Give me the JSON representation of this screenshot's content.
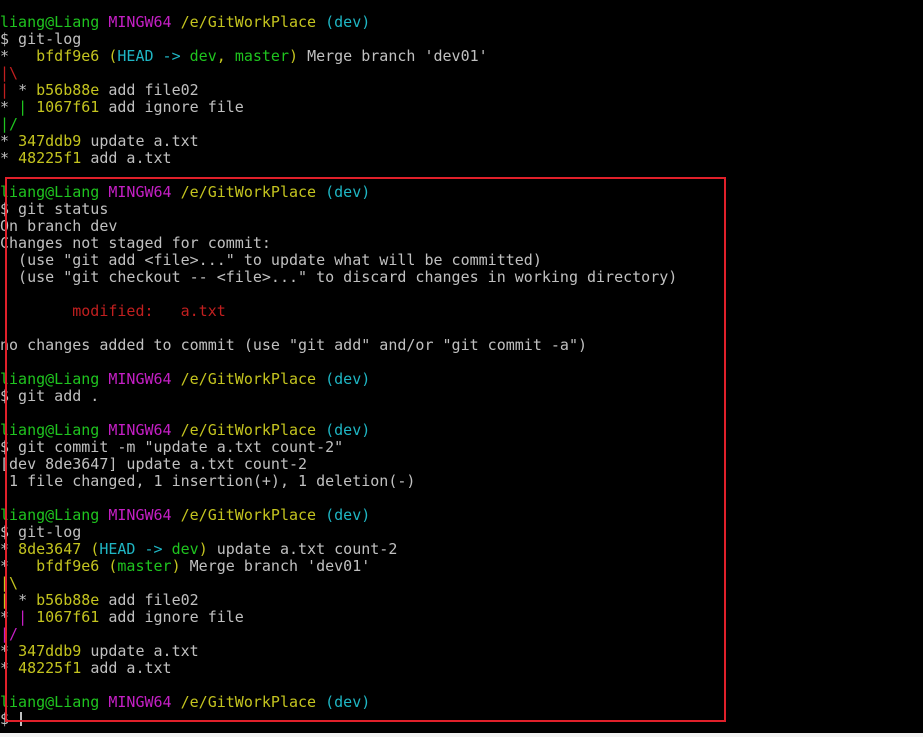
{
  "terminal": {
    "lines": [
      [
        {
          "t": "liang@Liang ",
          "c": "green"
        },
        {
          "t": "MINGW64 ",
          "c": "magenta"
        },
        {
          "t": "/e/GitWorkPlace",
          "c": "yellow"
        },
        {
          "t": " (dev)",
          "c": "cyan"
        }
      ],
      [
        {
          "t": "$ git-log",
          "c": "gray"
        }
      ],
      [
        {
          "t": "*   ",
          "c": "gray"
        },
        {
          "t": "bfdf9e6 ",
          "c": "yellow"
        },
        {
          "t": "(",
          "c": "yellow"
        },
        {
          "t": "HEAD -> ",
          "c": "cyan"
        },
        {
          "t": "dev",
          "c": "green"
        },
        {
          "t": ", ",
          "c": "yellow"
        },
        {
          "t": "master",
          "c": "green"
        },
        {
          "t": ") ",
          "c": "yellow"
        },
        {
          "t": "Merge branch 'dev01'",
          "c": "gray"
        }
      ],
      [
        {
          "t": "|\\",
          "c": "red"
        }
      ],
      [
        {
          "t": "| ",
          "c": "red"
        },
        {
          "t": "* ",
          "c": "gray"
        },
        {
          "t": "b56b88e ",
          "c": "yellow"
        },
        {
          "t": "add file02",
          "c": "gray"
        }
      ],
      [
        {
          "t": "* ",
          "c": "gray"
        },
        {
          "t": "| ",
          "c": "green"
        },
        {
          "t": "1067f61 ",
          "c": "yellow"
        },
        {
          "t": "add ignore file",
          "c": "gray"
        }
      ],
      [
        {
          "t": "|/",
          "c": "green"
        }
      ],
      [
        {
          "t": "* ",
          "c": "gray"
        },
        {
          "t": "347ddb9 ",
          "c": "yellow"
        },
        {
          "t": "update a.txt",
          "c": "gray"
        }
      ],
      [
        {
          "t": "* ",
          "c": "gray"
        },
        {
          "t": "48225f1 ",
          "c": "yellow"
        },
        {
          "t": "add a.txt",
          "c": "gray"
        }
      ],
      [],
      [
        {
          "t": "liang@Liang ",
          "c": "green"
        },
        {
          "t": "MINGW64 ",
          "c": "magenta"
        },
        {
          "t": "/e/GitWorkPlace",
          "c": "yellow"
        },
        {
          "t": " (dev)",
          "c": "cyan"
        }
      ],
      [
        {
          "t": "$ git status",
          "c": "gray"
        }
      ],
      [
        {
          "t": "On branch dev",
          "c": "gray"
        }
      ],
      [
        {
          "t": "Changes not staged for commit:",
          "c": "gray"
        }
      ],
      [
        {
          "t": "  (use \"git add <file>...\" to update what will be committed)",
          "c": "gray"
        }
      ],
      [
        {
          "t": "  (use \"git checkout -- <file>...\" to discard changes in working directory)",
          "c": "gray"
        }
      ],
      [],
      [
        {
          "t": "        modified:   a.txt",
          "c": "red"
        }
      ],
      [],
      [
        {
          "t": "no changes added to commit (use \"git add\" and/or \"git commit -a\")",
          "c": "gray"
        }
      ],
      [],
      [
        {
          "t": "liang@Liang ",
          "c": "green"
        },
        {
          "t": "MINGW64 ",
          "c": "magenta"
        },
        {
          "t": "/e/GitWorkPlace",
          "c": "yellow"
        },
        {
          "t": " (dev)",
          "c": "cyan"
        }
      ],
      [
        {
          "t": "$ git add .",
          "c": "gray"
        }
      ],
      [],
      [
        {
          "t": "liang@Liang ",
          "c": "green"
        },
        {
          "t": "MINGW64 ",
          "c": "magenta"
        },
        {
          "t": "/e/GitWorkPlace",
          "c": "yellow"
        },
        {
          "t": " (dev)",
          "c": "cyan"
        }
      ],
      [
        {
          "t": "$ git commit -m \"update a.txt count-2\"",
          "c": "gray"
        }
      ],
      [
        {
          "t": "[dev 8de3647] update a.txt count-2",
          "c": "gray"
        }
      ],
      [
        {
          "t": " 1 file changed, 1 insertion(+), 1 deletion(-)",
          "c": "gray"
        }
      ],
      [],
      [
        {
          "t": "liang@Liang ",
          "c": "green"
        },
        {
          "t": "MINGW64 ",
          "c": "magenta"
        },
        {
          "t": "/e/GitWorkPlace",
          "c": "yellow"
        },
        {
          "t": " (dev)",
          "c": "cyan"
        }
      ],
      [
        {
          "t": "$ git-log",
          "c": "gray"
        }
      ],
      [
        {
          "t": "* ",
          "c": "gray"
        },
        {
          "t": "8de3647 ",
          "c": "yellow"
        },
        {
          "t": "(",
          "c": "yellow"
        },
        {
          "t": "HEAD -> ",
          "c": "cyan"
        },
        {
          "t": "dev",
          "c": "green"
        },
        {
          "t": ") ",
          "c": "yellow"
        },
        {
          "t": "update a.txt count-2",
          "c": "gray"
        }
      ],
      [
        {
          "t": "*   ",
          "c": "gray"
        },
        {
          "t": "bfdf9e6 ",
          "c": "yellow"
        },
        {
          "t": "(",
          "c": "yellow"
        },
        {
          "t": "master",
          "c": "green"
        },
        {
          "t": ") ",
          "c": "yellow"
        },
        {
          "t": "Merge branch 'dev01'",
          "c": "gray"
        }
      ],
      [
        {
          "t": "|\\",
          "c": "yellow"
        }
      ],
      [
        {
          "t": "| ",
          "c": "yellow"
        },
        {
          "t": "* ",
          "c": "gray"
        },
        {
          "t": "b56b88e ",
          "c": "yellow"
        },
        {
          "t": "add file02",
          "c": "gray"
        }
      ],
      [
        {
          "t": "* ",
          "c": "gray"
        },
        {
          "t": "| ",
          "c": "magenta"
        },
        {
          "t": "1067f61 ",
          "c": "yellow"
        },
        {
          "t": "add ignore file",
          "c": "gray"
        }
      ],
      [
        {
          "t": "|/",
          "c": "magenta"
        }
      ],
      [
        {
          "t": "* ",
          "c": "gray"
        },
        {
          "t": "347ddb9 ",
          "c": "yellow"
        },
        {
          "t": "update a.txt",
          "c": "gray"
        }
      ],
      [
        {
          "t": "* ",
          "c": "gray"
        },
        {
          "t": "48225f1 ",
          "c": "yellow"
        },
        {
          "t": "add a.txt",
          "c": "gray"
        }
      ],
      [],
      [
        {
          "t": "liang@Liang ",
          "c": "green"
        },
        {
          "t": "MINGW64 ",
          "c": "magenta"
        },
        {
          "t": "/e/GitWorkPlace",
          "c": "yellow"
        },
        {
          "t": " (dev)",
          "c": "cyan"
        }
      ],
      [
        {
          "t": "$ ",
          "c": "gray"
        }
      ]
    ],
    "colors": {
      "background": "#000000",
      "green": "#1fc41f",
      "magenta": "#c51fc5",
      "yellow": "#c4c41f",
      "cyan": "#1fb6c4",
      "red": "#c11f1f",
      "gray": "#c0c0c0",
      "highlight_border": "#e0202a"
    }
  }
}
